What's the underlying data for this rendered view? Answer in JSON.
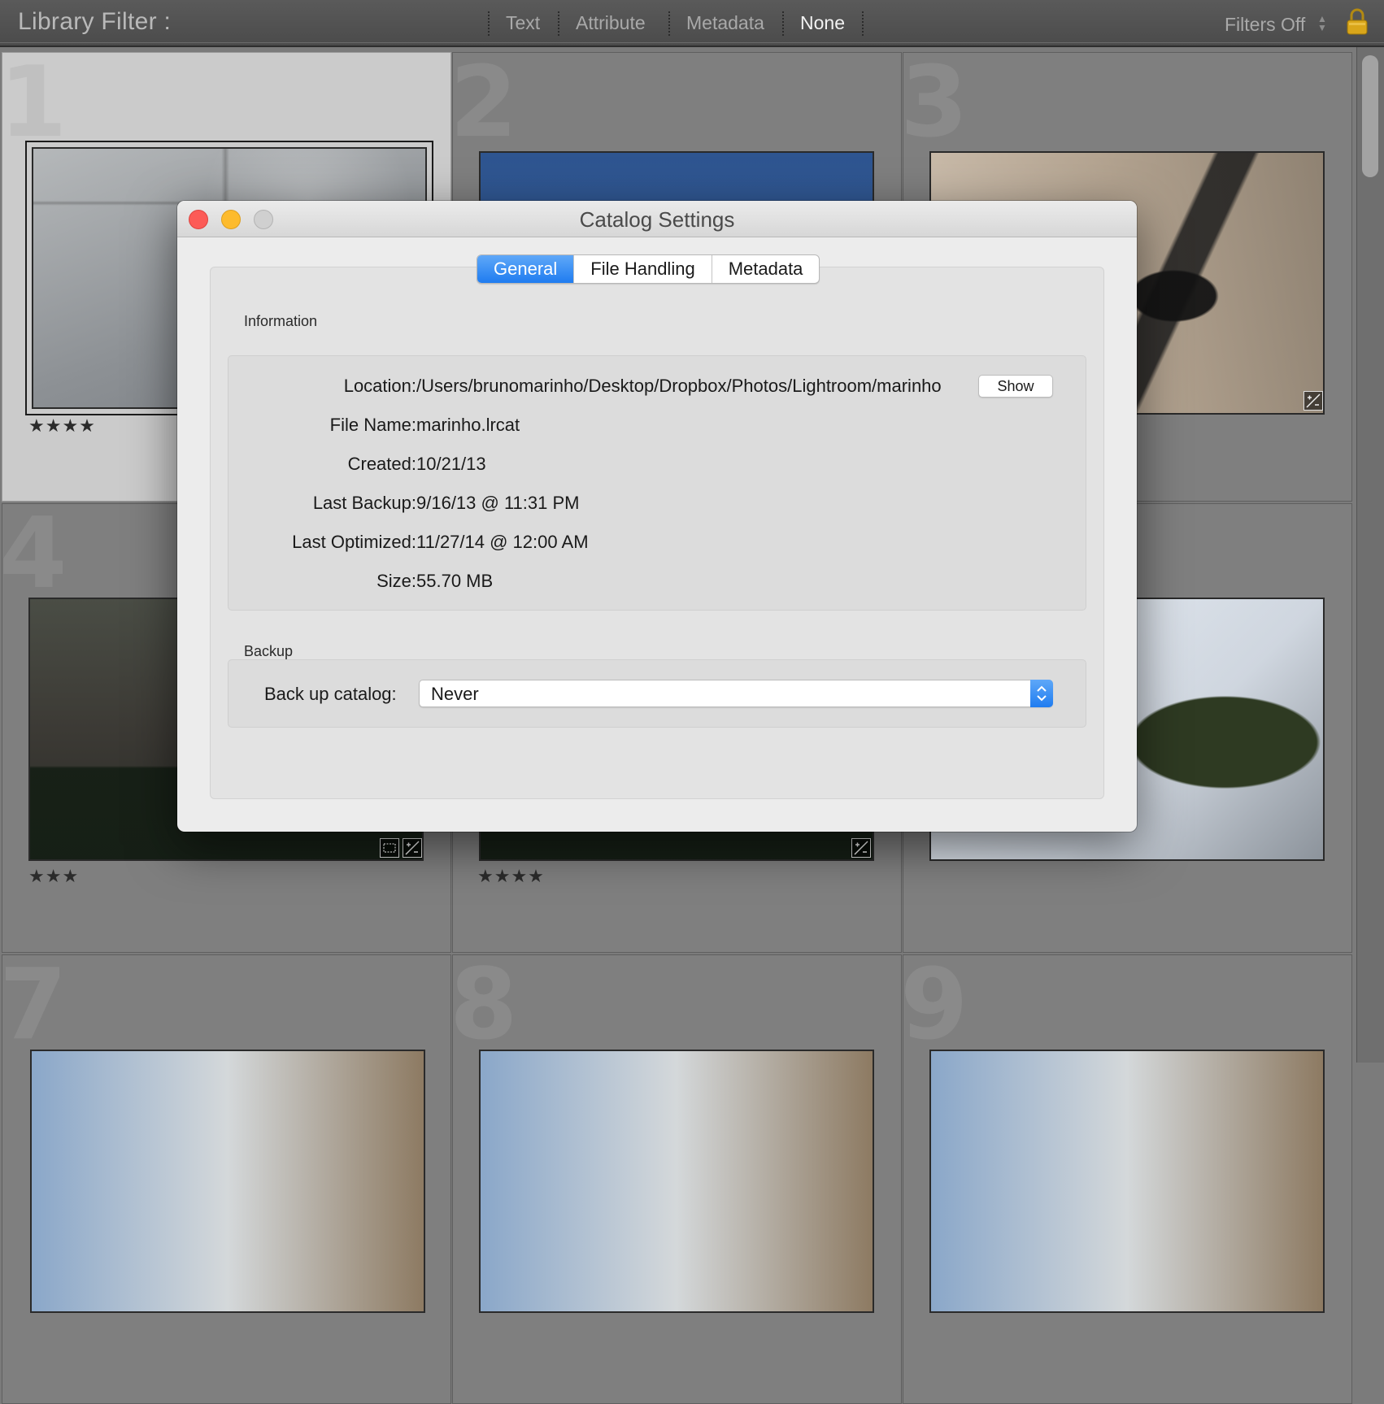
{
  "filter_bar": {
    "title": "Library Filter :",
    "options": [
      {
        "label": "Text",
        "active": false
      },
      {
        "label": "Attribute",
        "active": false
      },
      {
        "label": "Metadata",
        "active": false
      },
      {
        "label": "None",
        "active": true
      }
    ],
    "preset": "Filters Off",
    "preset_icon": "chevron-updown-icon",
    "lock_icon": "padlock-icon"
  },
  "grid": {
    "cells": [
      {
        "number": "1",
        "stars": "★★★★",
        "selected": true
      },
      {
        "number": "2",
        "stars": "",
        "selected": false
      },
      {
        "number": "3",
        "stars": "",
        "selected": false
      },
      {
        "number": "4",
        "stars": "★★★",
        "selected": false
      },
      {
        "number": "5",
        "stars": "★★★★",
        "selected": false
      },
      {
        "number": "6",
        "stars": "",
        "selected": false
      },
      {
        "number": "7",
        "stars": "",
        "selected": false
      },
      {
        "number": "8",
        "stars": "",
        "selected": false
      },
      {
        "number": "9",
        "stars": "",
        "selected": false
      }
    ]
  },
  "dialog": {
    "title": "Catalog Settings",
    "tabs": [
      {
        "label": "General",
        "active": true
      },
      {
        "label": "File Handling",
        "active": false
      },
      {
        "label": "Metadata",
        "active": false
      }
    ],
    "information": {
      "heading": "Information",
      "location_label": "Location:",
      "location_value": "/Users/brunomarinho/Desktop/Dropbox/Photos/Lightroom/marinho",
      "show_button": "Show",
      "file_name_label": "File Name:",
      "file_name_value": "marinho.lrcat",
      "created_label": "Created:",
      "created_value": "10/21/13",
      "last_backup_label": "Last Backup:",
      "last_backup_value": "9/16/13 @ 11:31 PM",
      "last_optimized_label": "Last Optimized:",
      "last_optimized_value": "11/27/14 @ 12:00 AM",
      "size_label": "Size:",
      "size_value": "55.70 MB"
    },
    "backup": {
      "heading": "Backup",
      "label": "Back up catalog:",
      "selected": "Never"
    }
  },
  "colors": {
    "accent": "#1f7cf0",
    "close": "#fc5b57",
    "minimize": "#fdbb2d",
    "zoom_disabled": "#d0d0d0"
  }
}
